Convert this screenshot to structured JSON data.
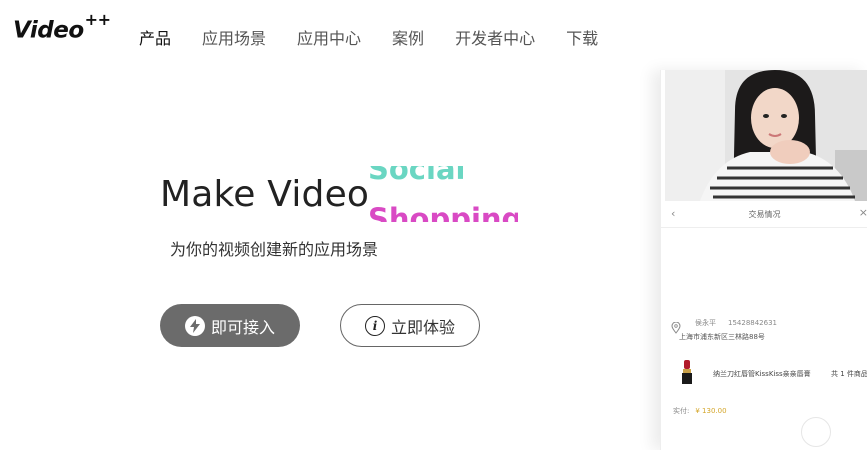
{
  "brand": {
    "name": "Video",
    "sup": "++"
  },
  "nav": {
    "items": [
      {
        "label": "产品"
      },
      {
        "label": "应用场景"
      },
      {
        "label": "应用中心"
      },
      {
        "label": "案例"
      },
      {
        "label": "开发者中心"
      },
      {
        "label": "下载"
      }
    ],
    "active_index": 0
  },
  "hero": {
    "title": "Make Video",
    "rotating_words": [
      "Social",
      "Shopping"
    ],
    "subtitle": "为你的视频创建新的应用场景",
    "primary_button": {
      "label": "即可接入",
      "icon": "lightning-icon"
    },
    "secondary_button": {
      "label": "立即体验",
      "icon": "info-icon"
    }
  },
  "phone_preview": {
    "header_title": "交易情况",
    "address": {
      "name": "侯永平",
      "phone": "15428842631",
      "detail": "上海市浦东新区三林路88号"
    },
    "product": {
      "name": "纳兰刀红唇管KissKiss亲亲唇膏",
      "count": "共 1 件商品"
    },
    "payment": {
      "label": "实付:",
      "price": "¥ 130.00"
    }
  },
  "colors": {
    "primary_button_bg": "#6b6b6b",
    "word_social": "#6ad6c2",
    "word_shopping": "#d94ac4",
    "price": "#d4a62a"
  }
}
